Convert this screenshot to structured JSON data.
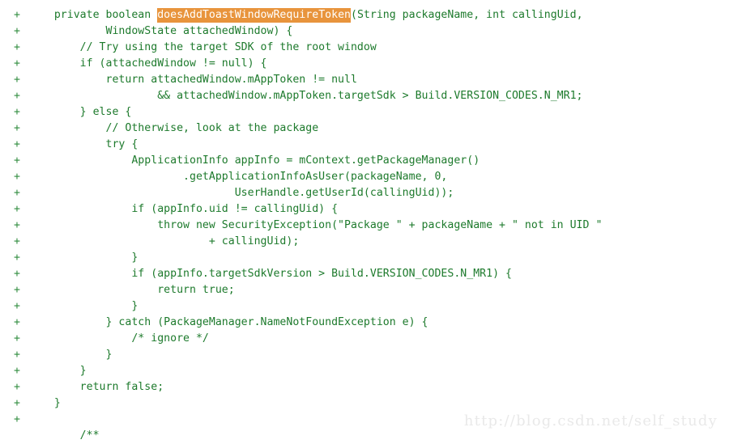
{
  "view": {
    "kind": "code-diff-added-lines",
    "language": "java",
    "colors": {
      "background": "#ffffff",
      "added_text": "#1d7a2c",
      "added_marker": "#2e8b3c",
      "highlight_background": "#e8943c",
      "highlight_text": "#ffffff",
      "watermark_text": "#e9e9e9"
    },
    "marker": "+",
    "highlight_token": "doesAddToastWindowRequireToken"
  },
  "watermark": {
    "text": "http://blog.csdn.net/self_study"
  },
  "lines": [
    {
      "marker": "+",
      "pre": "    private boolean ",
      "highlight": "doesAddToastWindowRequireToken",
      "post": "(String packageName, int callingUid,"
    },
    {
      "marker": "+",
      "text": "            WindowState attachedWindow) {"
    },
    {
      "marker": "+",
      "text": "        // Try using the target SDK of the root window"
    },
    {
      "marker": "+",
      "text": "        if (attachedWindow != null) {"
    },
    {
      "marker": "+",
      "text": "            return attachedWindow.mAppToken != null"
    },
    {
      "marker": "+",
      "text": "                    && attachedWindow.mAppToken.targetSdk > Build.VERSION_CODES.N_MR1;"
    },
    {
      "marker": "+",
      "text": "        } else {"
    },
    {
      "marker": "+",
      "text": "            // Otherwise, look at the package"
    },
    {
      "marker": "+",
      "text": "            try {"
    },
    {
      "marker": "+",
      "text": "                ApplicationInfo appInfo = mContext.getPackageManager()"
    },
    {
      "marker": "+",
      "text": "                        .getApplicationInfoAsUser(packageName, 0,"
    },
    {
      "marker": "+",
      "text": "                                UserHandle.getUserId(callingUid));"
    },
    {
      "marker": "+",
      "text": "                if (appInfo.uid != callingUid) {"
    },
    {
      "marker": "+",
      "text": "                    throw new SecurityException(\"Package \" + packageName + \" not in UID \""
    },
    {
      "marker": "+",
      "text": "                            + callingUid);"
    },
    {
      "marker": "+",
      "text": "                }"
    },
    {
      "marker": "+",
      "text": "                if (appInfo.targetSdkVersion > Build.VERSION_CODES.N_MR1) {"
    },
    {
      "marker": "+",
      "text": "                    return true;"
    },
    {
      "marker": "+",
      "text": "                }"
    },
    {
      "marker": "+",
      "text": "            } catch (PackageManager.NameNotFoundException e) {"
    },
    {
      "marker": "+",
      "text": "                /* ignore */"
    },
    {
      "marker": "+",
      "text": "            }"
    },
    {
      "marker": "+",
      "text": "        }"
    },
    {
      "marker": "+",
      "text": "        return false;"
    },
    {
      "marker": "+",
      "text": "    }"
    },
    {
      "marker": "+",
      "text": ""
    },
    {
      "marker": "",
      "text": "        /**"
    }
  ]
}
